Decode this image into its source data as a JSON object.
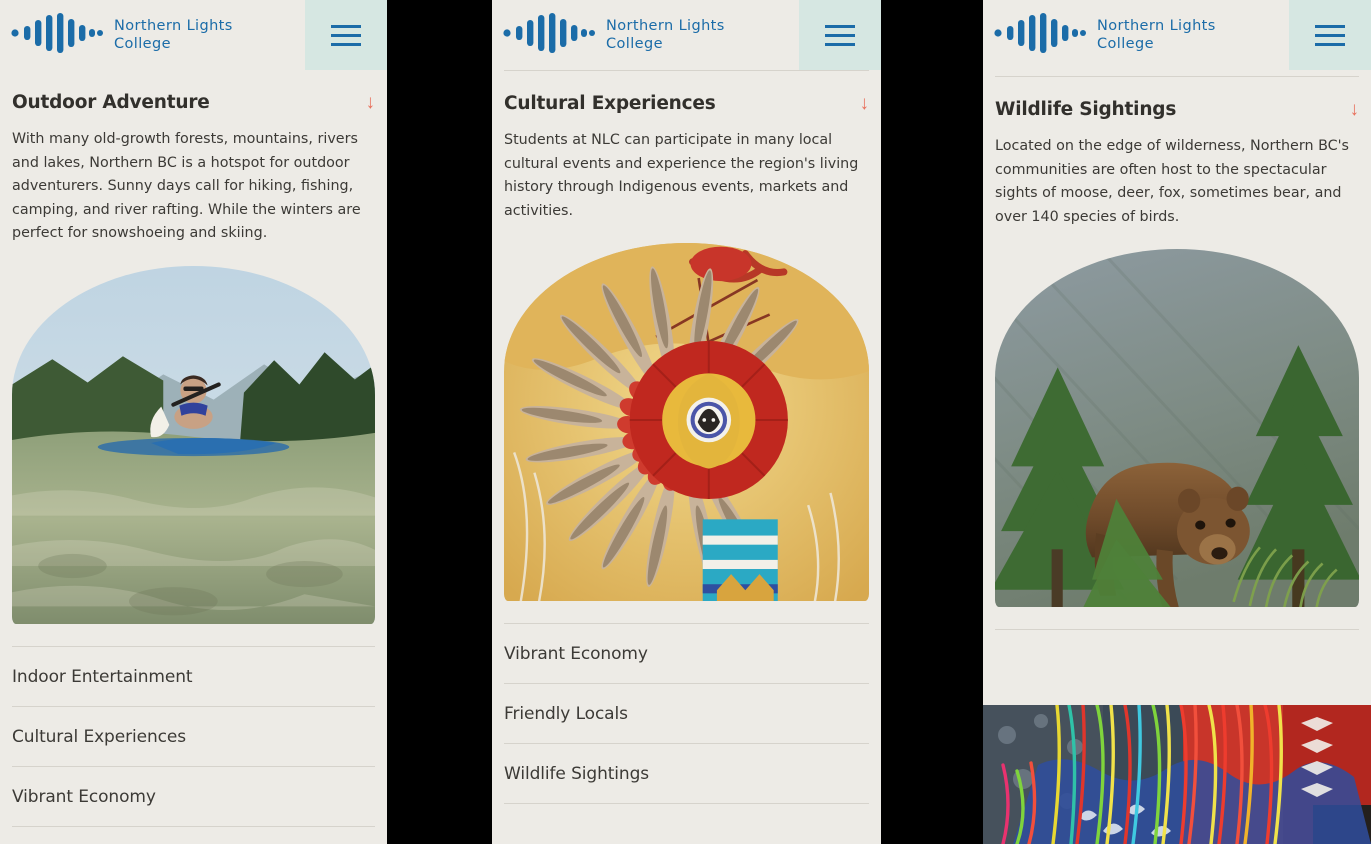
{
  "brand": {
    "name": "Northern Lights\nCollege",
    "logo_icon": "soundwave-logo-icon",
    "logo_color": "#1B6CA8"
  },
  "menu": {
    "icon": "hamburger-menu-icon",
    "background": "#D6E7E2",
    "bar_color": "#1B6CA8"
  },
  "theme": {
    "page_background": "#EDEBE6",
    "gap_background": "#000000",
    "accent_arrow": "#E8705C",
    "divider": "#D6D3CC",
    "heading_color": "#32302C",
    "body_color": "#3C3A36"
  },
  "panels": [
    {
      "id": "panel-outdoor-adventure",
      "has_top_divider": false,
      "open_item": {
        "title": "Outdoor Adventure",
        "arrow_icon": "arrow-down-icon",
        "body": "With many old-growth forests, mountains, rivers and lakes, Northern BC is a hotspot for outdoor adventurers. Sunny days call for hiking, fishing, camping, and river rafting. While the winters are perfect for snowshoeing and skiing.",
        "image_alt": "paddleboarder-on-river-image"
      },
      "items": [
        {
          "label": "Indoor Entertainment"
        },
        {
          "label": "Cultural Experiences"
        },
        {
          "label": "Vibrant Economy"
        }
      ]
    },
    {
      "id": "panel-cultural-experiences",
      "has_top_divider": true,
      "open_item": {
        "title": "Cultural Experiences",
        "arrow_icon": "arrow-down-icon",
        "body": "Students at NLC can participate in many local cultural events and experience the region's living history through Indigenous events, markets and activities.",
        "image_alt": "indigenous-feather-regalia-image"
      },
      "items": [
        {
          "label": "Vibrant Economy"
        },
        {
          "label": "Friendly Locals"
        },
        {
          "label": "Wildlife Sightings"
        }
      ]
    },
    {
      "id": "panel-wildlife-sightings",
      "has_top_divider": true,
      "open_item": {
        "title": "Wildlife Sightings",
        "arrow_icon": "arrow-down-icon",
        "body": "Located on the edge of wilderness, Northern BC's communities are often host to the spectacular sights of moose, deer, fox, sometimes bear, and over 140 species of birds.",
        "image_alt": "grizzly-bear-in-forest-image"
      },
      "items": [],
      "bottom_image_alt": "powwow-regalia-fringe-image"
    }
  ]
}
